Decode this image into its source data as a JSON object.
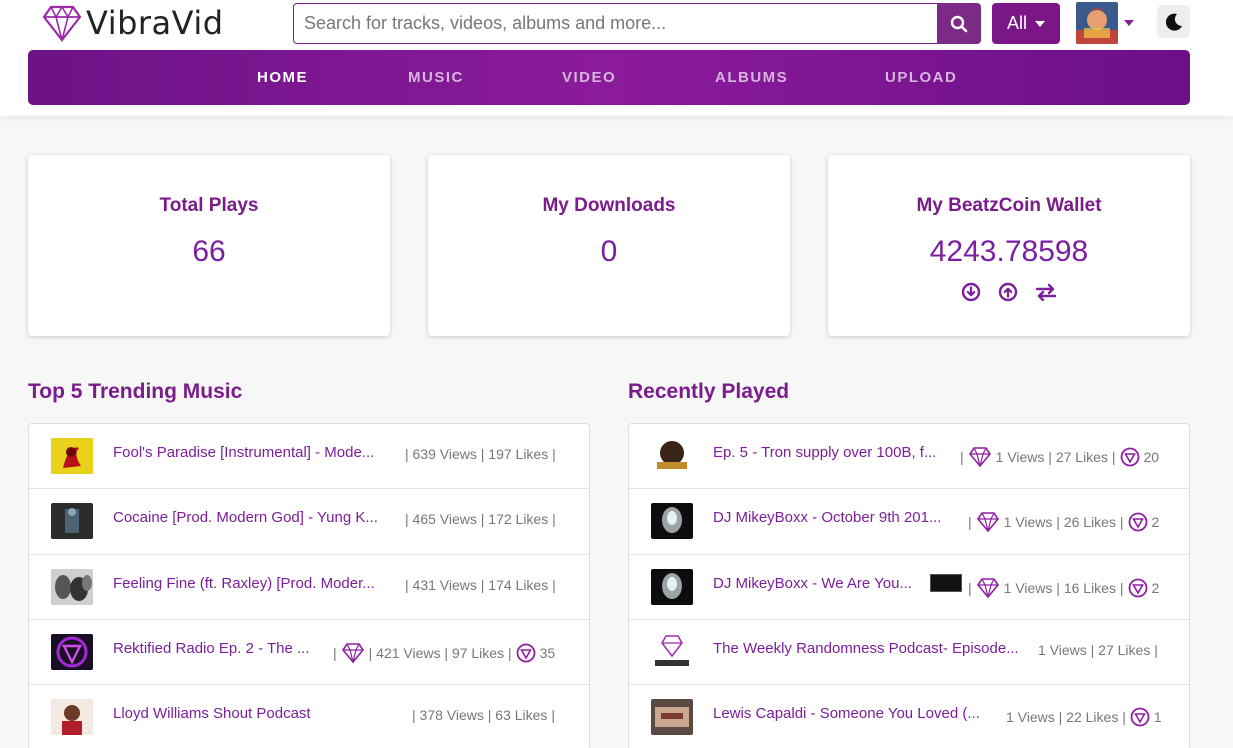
{
  "header": {
    "brand": "VibraVid",
    "search_placeholder": "Search for tracks, videos, albums and more...",
    "filter_label": "All",
    "icons": {
      "search": "search-icon",
      "theme": "moon-icon",
      "profile": "avatar"
    }
  },
  "nav": {
    "items": [
      "HOME",
      "MUSIC",
      "VIDEO",
      "ALBUMS",
      "UPLOAD"
    ],
    "active": "HOME"
  },
  "stats": {
    "total_plays": {
      "label": "Total Plays",
      "value": "66"
    },
    "downloads": {
      "label": "My Downloads",
      "value": "0"
    },
    "wallet": {
      "label": "My BeatzCoin Wallet",
      "value": "4243.78598",
      "actions": [
        "download-icon",
        "upload-icon",
        "transfer-icon"
      ]
    }
  },
  "trending": {
    "title": "Top 5 Trending Music",
    "items": [
      {
        "title": "Fool's Paradise [Instrumental] - Mode...",
        "stats": "| 639 Views | 197 Likes |"
      },
      {
        "title": "Cocaine [Prod. Modern God] - Yung K...",
        "stats": "| 465 Views | 172 Likes |"
      },
      {
        "title": "Feeling Fine (ft. Raxley) [Prod. Moder...",
        "stats": "| 431 Views | 174 Likes |"
      },
      {
        "title": "Rektified Radio Ep. 2 - The ...",
        "stats_pre": "|",
        "stats": "| 421 Views | 97 Likes |",
        "coins": "35"
      },
      {
        "title": "Lloyd Williams Shout Podcast",
        "stats": "| 378 Views | 63 Likes |"
      }
    ]
  },
  "recent": {
    "title": "Recently Played",
    "items": [
      {
        "title": "Ep. 5 - Tron supply over 100B, f...",
        "stats_pre": "|",
        "stats": "1 Views | 27 Likes |",
        "coins": "20"
      },
      {
        "title": "DJ MikeyBoxx - October 9th 201...",
        "stats_pre": "|",
        "stats": "1 Views | 26 Likes |",
        "coins": "2"
      },
      {
        "title": "DJ MikeyBoxx - We Are You...",
        "stats_pre": "|",
        "stats": "1 Views | 16 Likes |",
        "coins": "2",
        "explicit": true
      },
      {
        "title": "The Weekly Randomness Podcast- Episode...",
        "stats": "1 Views | 27 Likes |"
      },
      {
        "title": "Lewis Capaldi - Someone You Loved (...",
        "stats": "1 Views | 22 Likes |",
        "coins": "1"
      }
    ]
  },
  "colors": {
    "brand_purple": "#7a1c8c",
    "nav_gradient_start": "#6d1287",
    "nav_gradient_mid": "#8b1b9a"
  }
}
